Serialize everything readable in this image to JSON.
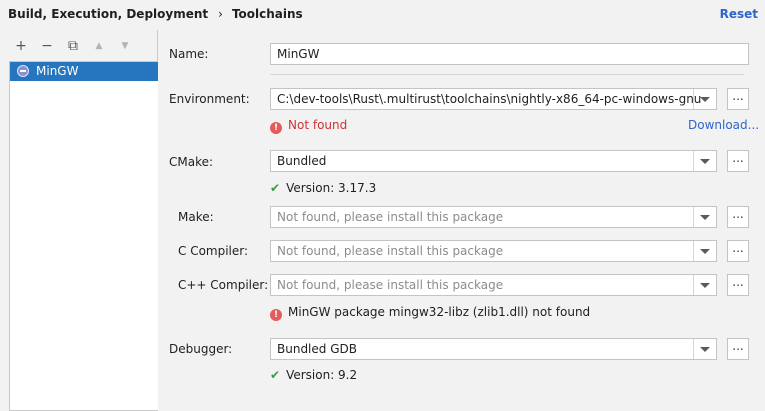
{
  "header": {
    "breadcrumb_parent": "Build, Execution, Deployment",
    "breadcrumb_sep": "›",
    "breadcrumb_current": "Toolchains",
    "reset_label": "Reset"
  },
  "toolbar": {
    "add": "+",
    "remove": "−",
    "copy": "⧉",
    "up": "▲",
    "down": "▼"
  },
  "toolchains": [
    {
      "label": "MinGW",
      "selected": true
    }
  ],
  "form": {
    "name_label": "Name:",
    "name_value": "MinGW",
    "environment_label": "Environment:",
    "environment_value": "C:\\dev-tools\\Rust\\.multirust\\toolchains\\nightly-x86_64-pc-windows-gnu",
    "environment_status": "Not found",
    "download_link": "Download...",
    "cmake_label": "CMake:",
    "cmake_value": "Bundled",
    "cmake_status": "Version: 3.17.3",
    "make_label": "Make:",
    "make_placeholder": "Not found, please install this package",
    "c_compiler_label": "C Compiler:",
    "c_compiler_placeholder": "Not found, please install this package",
    "cpp_compiler_label": "C++ Compiler:",
    "cpp_compiler_placeholder": "Not found, please install this package",
    "mingw_status": "MinGW package mingw32-libz (zlib1.dll) not found",
    "debugger_label": "Debugger:",
    "debugger_value": "Bundled GDB",
    "debugger_status": "Version: 9.2",
    "browse_label": "..."
  },
  "colors": {
    "accent": "#2675bf",
    "link": "#2f65ca",
    "error": "#e55b5b",
    "success": "#3a9b47"
  }
}
